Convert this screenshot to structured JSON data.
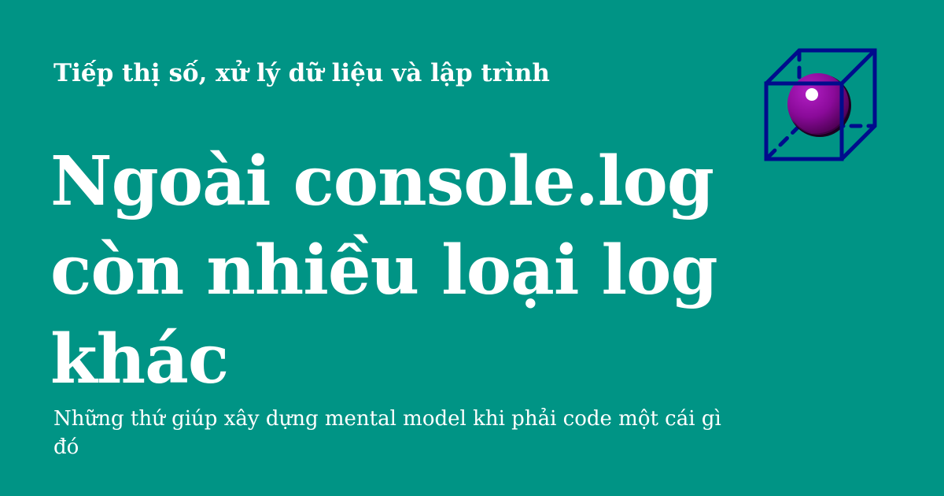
{
  "card": {
    "kicker": "Tiếp thị số, xử lý dữ liệu và lập trình",
    "title": "Ngoài console.log còn nhiều loại log khác",
    "subtitle": "Những thứ giúp xây dựng mental model khi phải code một cái gì đó",
    "background_color": "#009485",
    "text_color": "#ffffff",
    "logo": {
      "icon": "cube-with-sphere-icon",
      "cube_color": "#000c8c",
      "sphere_color": "#8a0a99"
    }
  }
}
